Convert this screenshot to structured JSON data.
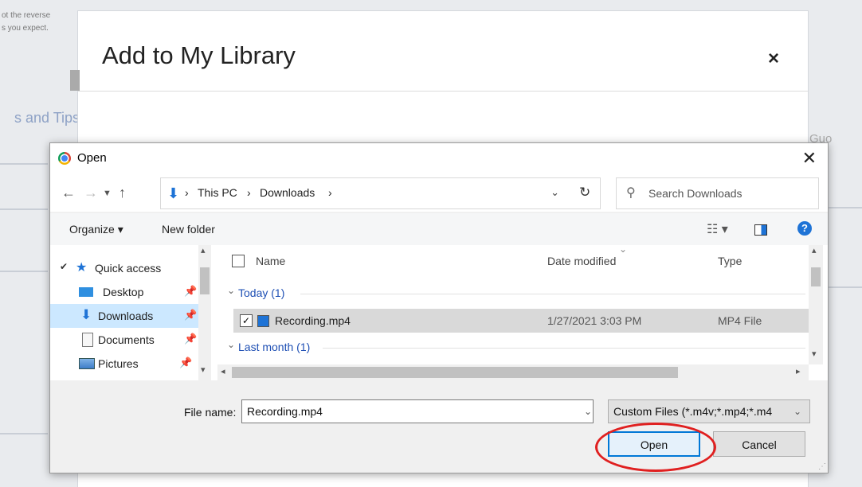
{
  "background": {
    "snippet_line1": "ot the reverse",
    "snippet_line2": "s you expect.",
    "section_text": "s and Tips",
    "side_text": "Guo"
  },
  "modal": {
    "title": "Add to My Library",
    "close_glyph": "×"
  },
  "dialog": {
    "title": "Open",
    "close_glyph": "✕",
    "address": {
      "crumbs": [
        "This PC",
        "Downloads"
      ]
    },
    "search_placeholder": "Search Downloads",
    "toolbar": {
      "organize": "Organize ▾",
      "new_folder": "New folder"
    },
    "nav": {
      "quick_access": "Quick access",
      "items": [
        {
          "label": "Desktop"
        },
        {
          "label": "Downloads"
        },
        {
          "label": "Documents"
        },
        {
          "label": "Pictures"
        }
      ]
    },
    "columns": {
      "name": "Name",
      "date_modified": "Date modified",
      "type": "Type"
    },
    "groups": {
      "today": "Today (1)",
      "last_month": "Last month (1)"
    },
    "file": {
      "name": "Recording.mp4",
      "date": "1/27/2021 3:03 PM",
      "type": "MP4 File"
    },
    "footer": {
      "file_name_label": "File name:",
      "file_name_value": "Recording.mp4",
      "filter": "Custom Files (*.m4v;*.mp4;*.m4",
      "open_label": "Open",
      "cancel_label": "Cancel"
    }
  },
  "colors": {
    "accent": "#0078d7",
    "highlight": "#e02020",
    "selection": "#cce8ff"
  }
}
